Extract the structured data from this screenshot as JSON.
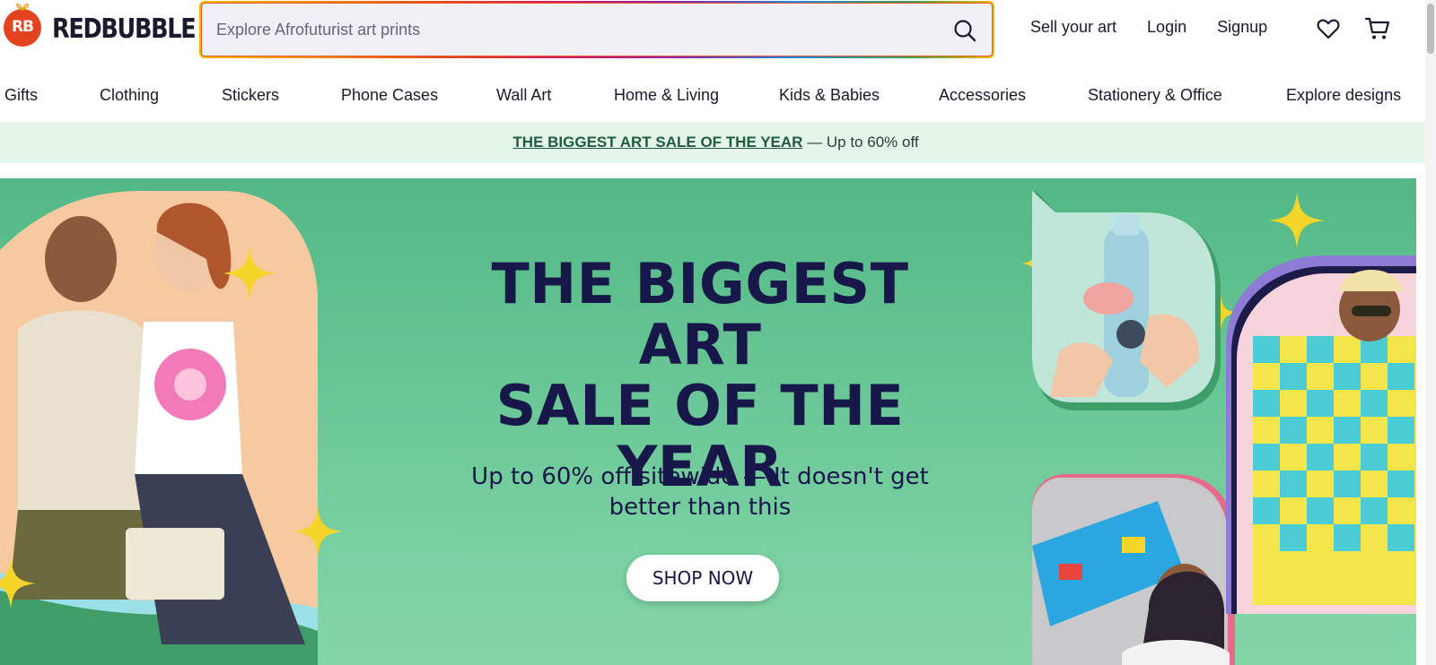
{
  "header": {
    "logo_text": "REDBUBBLE",
    "logo_badge": "RB",
    "search": {
      "placeholder": "Explore Afrofuturist art prints",
      "icon": "search-icon"
    },
    "links": {
      "sell": "Sell your art",
      "login": "Login",
      "signup": "Signup"
    },
    "icons": {
      "wishlist": "heart-icon",
      "cart": "cart-icon"
    }
  },
  "nav": {
    "items": [
      {
        "label": "Gifts"
      },
      {
        "label": "Clothing"
      },
      {
        "label": "Stickers"
      },
      {
        "label": "Phone Cases"
      },
      {
        "label": "Wall Art"
      },
      {
        "label": "Home & Living"
      },
      {
        "label": "Kids & Babies"
      },
      {
        "label": "Accessories"
      },
      {
        "label": "Stationery & Office"
      },
      {
        "label": "Explore designs"
      }
    ]
  },
  "promo": {
    "link_text": "THE BIGGEST ART SALE OF THE YEAR",
    "text": " — Up to 60% off"
  },
  "hero": {
    "title_lines": [
      "THE BIGGEST ART",
      "SALE OF THE",
      "YEAR"
    ],
    "subtitle_lines": [
      "Up to 60% off sitewide — It doesn't get",
      "better than this"
    ],
    "cta": "SHOP NOW"
  },
  "colors": {
    "brand": "#e4431f",
    "hero_bg": "#6fca9a",
    "promo_bg": "#e3f6e8",
    "hero_text": "#171749",
    "sparkle": "#f6d52a"
  }
}
